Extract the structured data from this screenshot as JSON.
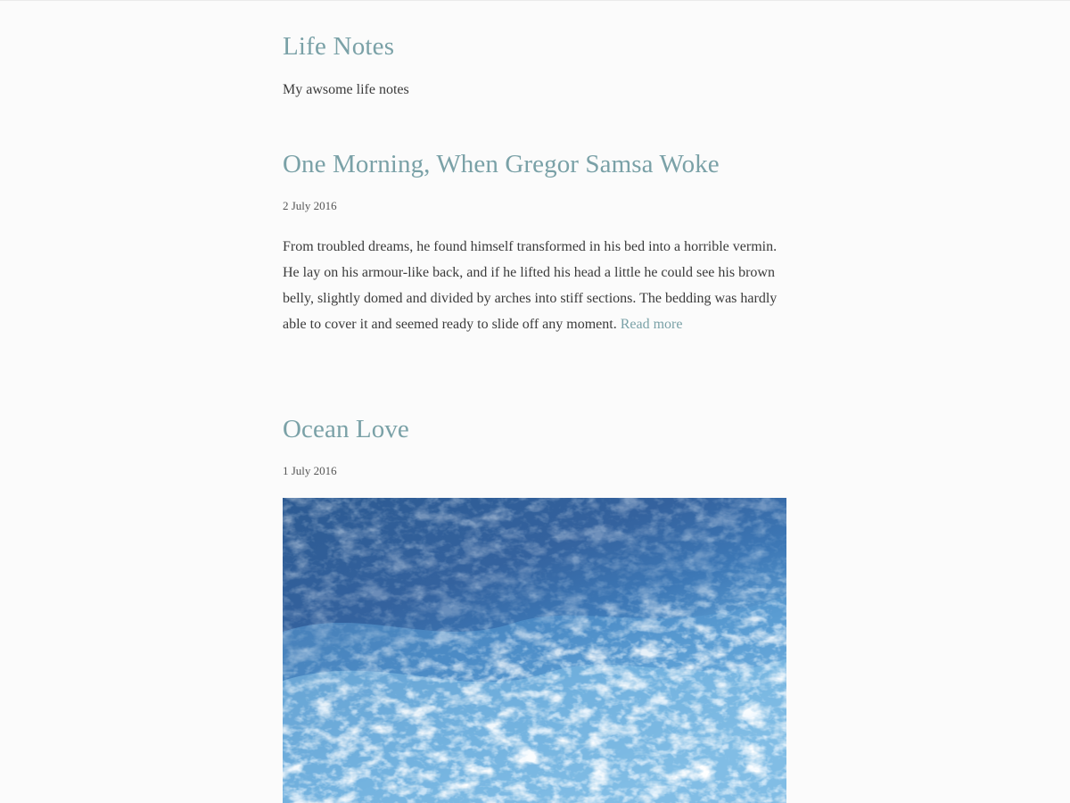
{
  "site": {
    "title": "Life Notes",
    "tagline": "My awsome life notes"
  },
  "posts": [
    {
      "title": "One Morning, When Gregor Samsa Woke",
      "date": "2 July 2016",
      "excerpt": "From troubled dreams, he found himself transformed in his bed into a horrible vermin. He lay on his armour-like back, and if he lifted his head a little he could see his brown belly, slightly domed and divided by arches into stiff sections. The bedding was hardly able to cover it and seemed ready to slide off any moment.",
      "read_more": "Read more"
    },
    {
      "title": "Ocean Love",
      "date": "1 July 2016",
      "image": {
        "subject": "ocean-waves-photo",
        "colors": [
          "#2f5d94",
          "#3c73b0",
          "#7fbbe3",
          "#ffffff"
        ]
      }
    }
  ],
  "theme": {
    "accent": "#7aa1a7",
    "text": "#3a3a3a",
    "background": "#fbfbfb"
  }
}
